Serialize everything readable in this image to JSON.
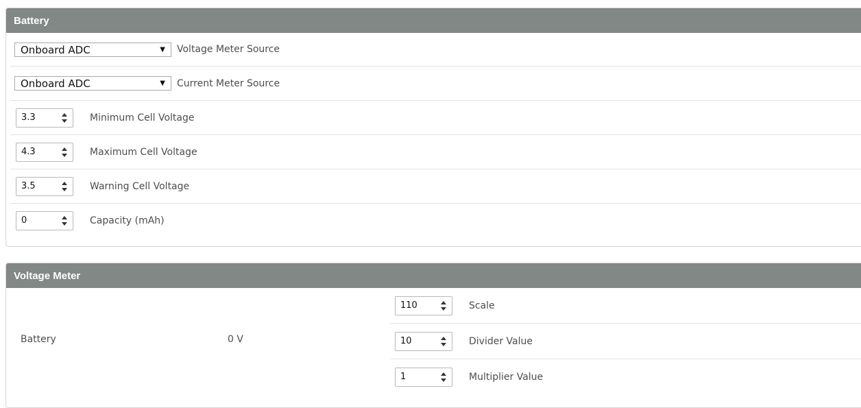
{
  "battery": {
    "title": "Battery",
    "voltage_meter_source": {
      "value": "Onboard ADC",
      "label": "Voltage Meter Source"
    },
    "current_meter_source": {
      "value": "Onboard ADC",
      "label": "Current Meter Source"
    },
    "min_cell_voltage": {
      "value": "3.3",
      "label": "Minimum Cell Voltage"
    },
    "max_cell_voltage": {
      "value": "4.3",
      "label": "Maximum Cell Voltage"
    },
    "warning_cell_voltage": {
      "value": "3.5",
      "label": "Warning Cell Voltage"
    },
    "capacity": {
      "value": "0",
      "label": "Capacity (mAh)"
    }
  },
  "voltage_meter": {
    "title": "Voltage Meter",
    "meter_name": "Battery",
    "reading": "0 V",
    "scale": {
      "value": "110",
      "label": "Scale"
    },
    "divider": {
      "value": "10",
      "label": "Divider Value"
    },
    "multiplier": {
      "value": "1",
      "label": "Multiplier Value"
    }
  },
  "icons": {
    "dropdown": "triangle-down",
    "spinner": "up-down-arrows"
  }
}
